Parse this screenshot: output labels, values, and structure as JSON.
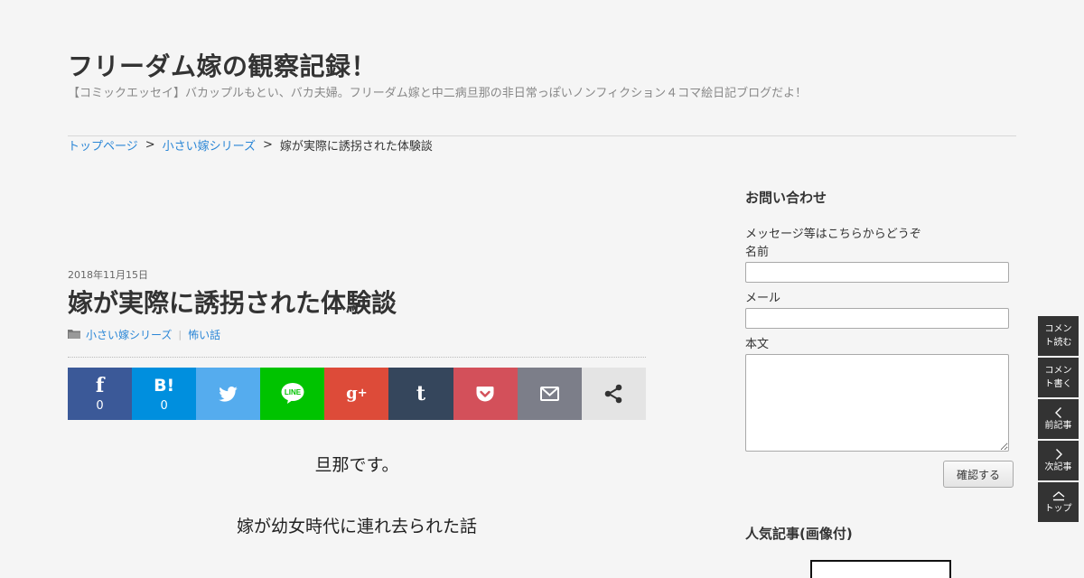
{
  "site": {
    "title": "フリーダム嫁の観察記録！",
    "description": "【コミックエッセイ】バカップルもとい、バカ夫婦。フリーダム嫁と中二病旦那の非日常っぽいノンフィクション４コマ絵日記ブログだよ！"
  },
  "breadcrumb": {
    "home": "トップページ",
    "category": "小さい嫁シリーズ",
    "current": "嫁が実際に誘拐された体験談",
    "separator": ">"
  },
  "post": {
    "date": "2018年11月15日",
    "title": "嫁が実際に誘拐された体験談",
    "categories": [
      "小さい嫁シリーズ",
      "怖い話"
    ],
    "body": [
      "旦那です。",
      "嫁が幼女時代に連れ去られた話"
    ]
  },
  "share": {
    "facebook": {
      "icon": "facebook-icon",
      "count": "0",
      "color": "#3b5998"
    },
    "hatena": {
      "icon": "hatena-bookmark-icon",
      "count": "0",
      "color": "#008fde"
    },
    "twitter": {
      "icon": "twitter-bird-icon",
      "color": "#55acee"
    },
    "line": {
      "icon": "line-icon",
      "color": "#00c300"
    },
    "googleplus": {
      "icon": "google-plus-icon",
      "color": "#dd4b39"
    },
    "tumblr": {
      "icon": "tumblr-icon",
      "color": "#35465c"
    },
    "pocket": {
      "icon": "pocket-icon",
      "color": "#d3505a"
    },
    "mail": {
      "icon": "mail-envelope-icon",
      "color": "#7c7e89"
    },
    "more": {
      "icon": "share-icon",
      "color": "#e4e4e4"
    }
  },
  "sidebar": {
    "contact": {
      "title": "お問い合わせ",
      "intro": "メッセージ等はこちらからどうぞ",
      "name_label": "名前",
      "email_label": "メール",
      "body_label": "本文",
      "submit_label": "確認する"
    },
    "popular": {
      "title": "人気記事(画像付)"
    }
  },
  "fixed_nav": {
    "read_comments": "コメント読む",
    "write_comment": "コメント書く",
    "prev_post": "前記事",
    "next_post": "次記事",
    "top": "トップ"
  },
  "colors": {
    "link": "#2a86d6",
    "nav_bg": "#333333",
    "page_bg": "#f5f5f5"
  }
}
